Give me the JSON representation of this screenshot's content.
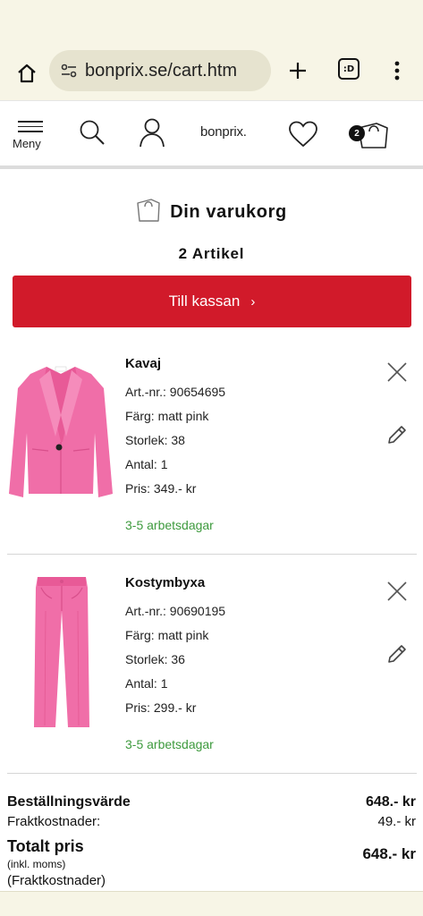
{
  "browser": {
    "url": "bonprix.se/cart.htm",
    "tab_count": ":D"
  },
  "header": {
    "menu_label": "Meny",
    "logo": "bonprix.",
    "cart_badge": "2"
  },
  "cart": {
    "title": "Din varukorg",
    "count_label": "2 Artikel",
    "checkout_label": "Till kassan",
    "checkout_chevron": "›"
  },
  "items": [
    {
      "name": "Kavaj",
      "art": "Art.-nr.: 90654695",
      "color": "Färg: matt pink",
      "size": "Storlek: 38",
      "qty": "Antal: 1",
      "price": "Pris: 349.- kr",
      "delivery": "3-5 arbetsdagar"
    },
    {
      "name": "Kostymbyxa",
      "art": "Art.-nr.: 90690195",
      "color": "Färg: matt pink",
      "size": "Storlek: 36",
      "qty": "Antal: 1",
      "price": "Pris: 299.- kr",
      "delivery": "3-5 arbetsdagar"
    }
  ],
  "summary": {
    "order_value_label": "Beställningsvärde",
    "order_value": "648.- kr",
    "shipping_label": "Fraktkostnader:",
    "shipping_value": "49.- kr",
    "total_label": "Totalt pris",
    "total_value": "648.- kr",
    "vat_note": "(inkl. moms)",
    "shipping_note": "(Fraktkostnader)"
  },
  "colors": {
    "accent": "#d11a2a",
    "delivery_green": "#3d9a3d",
    "product_pink": "#f06ea8"
  }
}
